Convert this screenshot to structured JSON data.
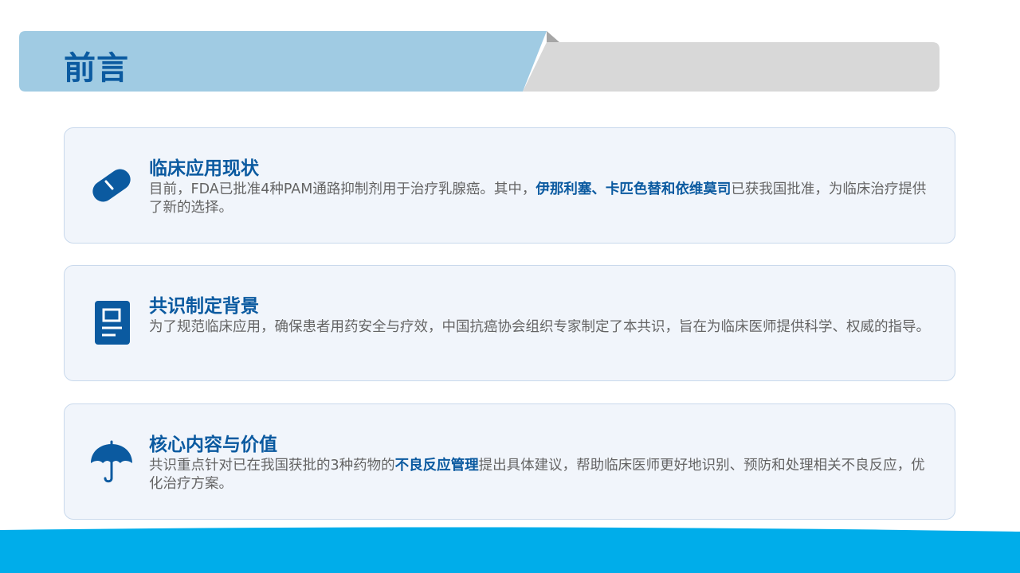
{
  "header": {
    "title": "前言"
  },
  "colors": {
    "title_blue": "#0b5aa0",
    "header_band": "#a0cbe3",
    "header_gray": "#d8d8d8",
    "card_bg": "#f1f5fb",
    "card_border": "#c9d9ec",
    "body_text": "#646464",
    "footer_cyan": "#00adea"
  },
  "cards": [
    {
      "icon": "pill-icon",
      "title": "临床应用现状",
      "body_before": "目前，FDA已批准4种PAM通路抑制剂用于治疗乳腺癌。其中，",
      "body_highlight": "伊那利塞、卡匹色替和依维莫司",
      "body_after": "已获我国批准，为临床治疗提供了新的选择。"
    },
    {
      "icon": "document-icon",
      "title": "共识制定背景",
      "body_before": "为了规范临床应用，确保患者用药安全与疗效，中国抗癌协会组织专家制定了本共识，旨在为临床医师提供科学、权威的指导。",
      "body_highlight": "",
      "body_after": ""
    },
    {
      "icon": "umbrella-icon",
      "title": "核心内容与价值",
      "body_before": "共识重点针对已在我国获批的3种药物的",
      "body_highlight": "不良反应管理",
      "body_after": "提出具体建议，帮助临床医师更好地识别、预防和处理相关不良反应，优化治疗方案。"
    }
  ]
}
